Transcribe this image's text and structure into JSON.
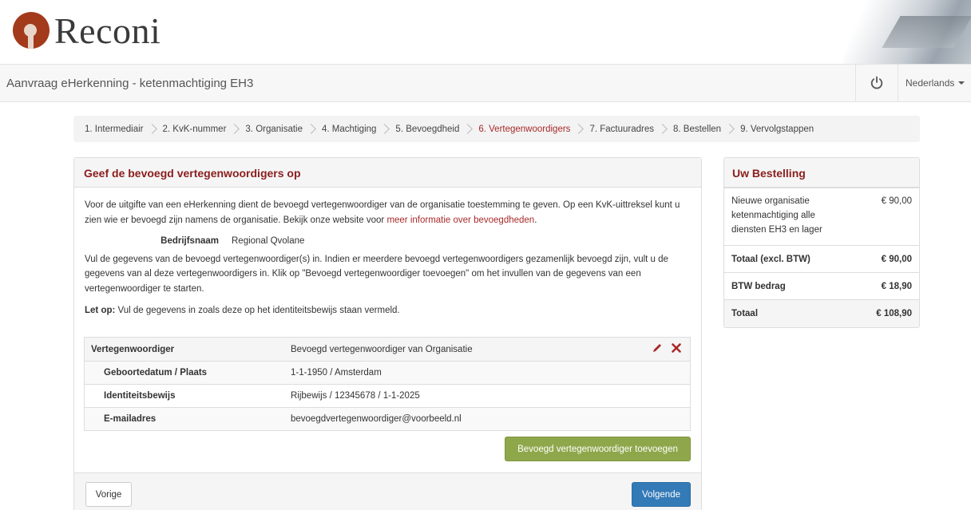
{
  "header": {
    "logo_text": "Reconi"
  },
  "navbar": {
    "title": "Aanvraag eHerkenning - ketenmachtiging EH3",
    "language": "Nederlands"
  },
  "steps": [
    {
      "label": "1. Intermediair",
      "active": false
    },
    {
      "label": "2. KvK-nummer",
      "active": false
    },
    {
      "label": "3. Organisatie",
      "active": false
    },
    {
      "label": "4. Machtiging",
      "active": false
    },
    {
      "label": "5. Bevoegdheid",
      "active": false
    },
    {
      "label": "6. Vertegenwoordigers",
      "active": true
    },
    {
      "label": "7. Factuuradres",
      "active": false
    },
    {
      "label": "8. Bestellen",
      "active": false
    },
    {
      "label": "9. Vervolgstappen",
      "active": false
    }
  ],
  "main": {
    "heading": "Geef de bevoegd vertegenwoordigers op",
    "intro": "Voor de uitgifte van een eHerkenning dient de bevoegd vertegenwoordiger van de organisatie toestemming te geven. Op een KvK-uittreksel kunt u zien wie er bevoegd zijn namens de organisatie. Bekijk onze website voor ",
    "intro_link": "meer informatie over bevoegdheden",
    "intro_end": ".",
    "company_label": "Bedrijfsnaam",
    "company_value": "Regional Qvolane",
    "instructions": "Vul de gegevens van de bevoegd vertegenwoordiger(s) in. Indien er meerdere bevoegd vertegenwoordigers gezamenlijk bevoegd zijn, vult u de gegevens van al deze vertegenwoordigers in. Klik op \"Bevoegd vertegenwoordiger toevoegen\" om het invullen van de gegevens van een vertegenwoordiger te starten.",
    "note_label": "Let op:",
    "note_text": " Vul de gegevens in zoals deze op het identiteitsbewijs staan vermeld.",
    "representative": {
      "head_label": "Vertegenwoordiger",
      "head_value": "Bevoegd vertegenwoordiger van Organisatie",
      "rows": [
        {
          "label": "Geboortedatum  /  Plaats",
          "value": "1-1-1950  /  Amsterdam"
        },
        {
          "label": "Identiteitsbewijs",
          "value": "Rijbewijs  /  12345678  /  1-1-2025"
        },
        {
          "label": "E-mailadres",
          "value": "bevoegdvertegenwoordiger@voorbeeld.nl"
        }
      ]
    },
    "add_button": "Bevoegd vertegenwoordiger toevoegen",
    "prev_button": "Vorige",
    "next_button": "Volgende"
  },
  "order": {
    "heading": "Uw Bestelling",
    "item_desc": "Nieuwe organisatie ketenmachtiging alle diensten EH3 en lager",
    "item_price": "€ 90,00",
    "subtotal_label": "Totaal (excl. BTW)",
    "subtotal_value": "€ 90,00",
    "vat_label": "BTW bedrag",
    "vat_value": "€ 18,90",
    "total_label": "Totaal",
    "total_value": "€ 108,90"
  },
  "colors": {
    "brand": "#a82a2a",
    "add_button": "#8fa74b",
    "primary_button": "#337ab7"
  },
  "icons": {
    "power": "power-icon",
    "edit": "pencil-icon",
    "delete": "close-icon"
  }
}
